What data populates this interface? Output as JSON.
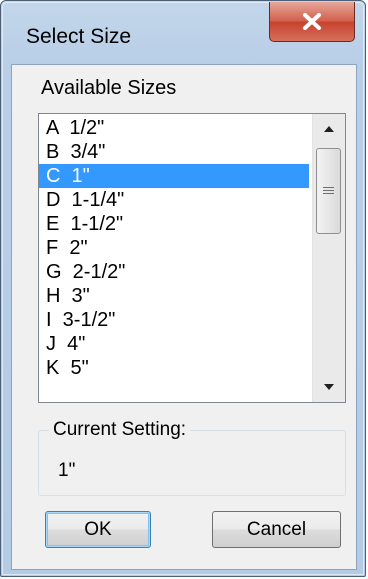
{
  "window": {
    "title": "Select Size",
    "close_icon": "close-x-icon"
  },
  "sizes": {
    "label": "Available Sizes",
    "items": [
      "A  1/2\"",
      "B  3/4\"",
      "C  1\"",
      "D  1-1/4\"",
      "E  1-1/2\"",
      "F  2\"",
      "G  2-1/2\"",
      "H  3\"",
      "I  3-1/2\"",
      "J  4\"",
      "K  5\""
    ],
    "selected_index": 2
  },
  "current": {
    "label": "Current Setting:",
    "value": "1\""
  },
  "buttons": {
    "ok": "OK",
    "cancel": "Cancel"
  },
  "colors": {
    "selection": "#3399ff",
    "close_button": "#c7432e"
  }
}
